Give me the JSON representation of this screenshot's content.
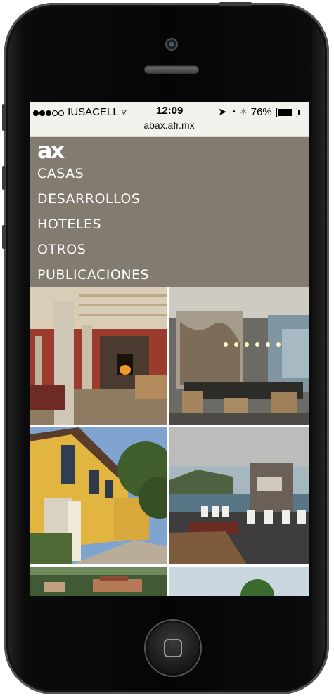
{
  "status_bar": {
    "carrier": "IUSACELL",
    "time": "12:09",
    "battery_percent": "76%",
    "battery_level": 0.76,
    "url": "abax.afr.mx"
  },
  "site": {
    "logo_text": "ax",
    "brand_color": "#837b70",
    "menu": [
      "CASAS",
      "DESARROLLOS",
      "HOTELES",
      "OTROS",
      "PUBLICACIONES"
    ]
  },
  "gallery": {
    "tiles": [
      {
        "name": "living-room-photo"
      },
      {
        "name": "dining-room-photo"
      },
      {
        "name": "yellow-house-photo"
      },
      {
        "name": "lakeside-terrace-photo"
      },
      {
        "name": "hillside-houses-photo"
      },
      {
        "name": "sky-tree-photo"
      }
    ]
  }
}
